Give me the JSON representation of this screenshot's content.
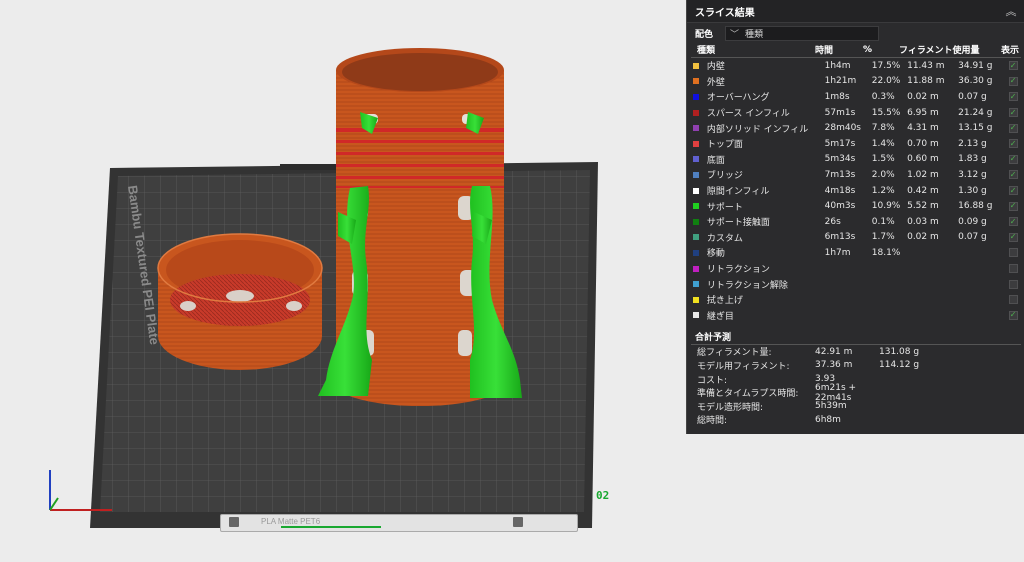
{
  "panel": {
    "title": "スライス結果",
    "color_scheme_label": "配色",
    "color_scheme_value": "種類",
    "columns": {
      "type": "種類",
      "time": "時間",
      "percent": "%",
      "filament": "フィラメント使用量",
      "display": "表示"
    },
    "rows": [
      {
        "label": "内壁",
        "color": "#f0c040",
        "time": "1h4m",
        "percent": "17.5%",
        "length": "11.43 m",
        "weight": "34.91 g",
        "checked": true
      },
      {
        "label": "外壁",
        "color": "#e07020",
        "time": "1h21m",
        "percent": "22.0%",
        "length": "11.88 m",
        "weight": "36.30 g",
        "checked": true
      },
      {
        "label": "オーバーハング",
        "color": "#1010e0",
        "time": "1m8s",
        "percent": "0.3%",
        "length": "0.02 m",
        "weight": "0.07 g",
        "checked": true
      },
      {
        "label": "スパース インフィル",
        "color": "#b02020",
        "time": "57m1s",
        "percent": "15.5%",
        "length": "6.95 m",
        "weight": "21.24 g",
        "checked": true
      },
      {
        "label": "内部ソリッド インフィル",
        "color": "#9040b0",
        "time": "28m40s",
        "percent": "7.8%",
        "length": "4.31 m",
        "weight": "13.15 g",
        "checked": true
      },
      {
        "label": "トップ面",
        "color": "#e04040",
        "time": "5m17s",
        "percent": "1.4%",
        "length": "0.70 m",
        "weight": "2.13 g",
        "checked": true
      },
      {
        "label": "底面",
        "color": "#6060d0",
        "time": "5m34s",
        "percent": "1.5%",
        "length": "0.60 m",
        "weight": "1.83 g",
        "checked": true
      },
      {
        "label": "ブリッジ",
        "color": "#5080c0",
        "time": "7m13s",
        "percent": "2.0%",
        "length": "1.02 m",
        "weight": "3.12 g",
        "checked": true
      },
      {
        "label": "隙間インフィル",
        "color": "#ffffff",
        "time": "4m18s",
        "percent": "1.2%",
        "length": "0.42 m",
        "weight": "1.30 g",
        "checked": true
      },
      {
        "label": "サポート",
        "color": "#20d020",
        "time": "40m3s",
        "percent": "10.9%",
        "length": "5.52 m",
        "weight": "16.88 g",
        "checked": true
      },
      {
        "label": "サポート接触面",
        "color": "#108010",
        "time": "26s",
        "percent": "0.1%",
        "length": "0.03 m",
        "weight": "0.09 g",
        "checked": true
      },
      {
        "label": "カスタム",
        "color": "#40a080",
        "time": "6m13s",
        "percent": "1.7%",
        "length": "0.02 m",
        "weight": "0.07 g",
        "checked": true
      },
      {
        "label": "移動",
        "color": "#204080",
        "time": "1h7m",
        "percent": "18.1%",
        "length": "",
        "weight": "",
        "checked": false
      },
      {
        "label": "リトラクション",
        "color": "#c020c0",
        "time": "",
        "percent": "",
        "length": "",
        "weight": "",
        "checked": false
      },
      {
        "label": "リトラクション解除",
        "color": "#40a0d0",
        "time": "",
        "percent": "",
        "length": "",
        "weight": "",
        "checked": false
      },
      {
        "label": "拭き上げ",
        "color": "#f0e020",
        "time": "",
        "percent": "",
        "length": "",
        "weight": "",
        "checked": false
      },
      {
        "label": "継ぎ目",
        "color": "#e8e8e8",
        "time": "",
        "percent": "",
        "length": "",
        "weight": "",
        "checked": true
      }
    ],
    "summary_title": "合計予測",
    "summary": [
      {
        "label": "総フィラメント量:",
        "v1": "42.91 m",
        "v2": "131.08 g"
      },
      {
        "label": "モデル用フィラメント:",
        "v1": "37.36 m",
        "v2": "114.12 g"
      },
      {
        "label": "コスト:",
        "v1": "3.93",
        "v2": ""
      },
      {
        "label": "準備とタイムラプス時間:",
        "v1": "6m21s + 22m41s",
        "v2": ""
      },
      {
        "label": "モデル造形時間:",
        "v1": "5h39m",
        "v2": ""
      },
      {
        "label": "総時間:",
        "v1": "6h8m",
        "v2": ""
      }
    ]
  },
  "viewport": {
    "plate_label": "Bambu Textured PEI Plate",
    "plate_number": "02",
    "filament_label": "PLA Matte PET6"
  },
  "colors": {
    "panel_bg": "#2b2b2d",
    "plate_bg": "#3d3d3d",
    "model_orange": "#c8561e",
    "support_green": "#20c020"
  }
}
